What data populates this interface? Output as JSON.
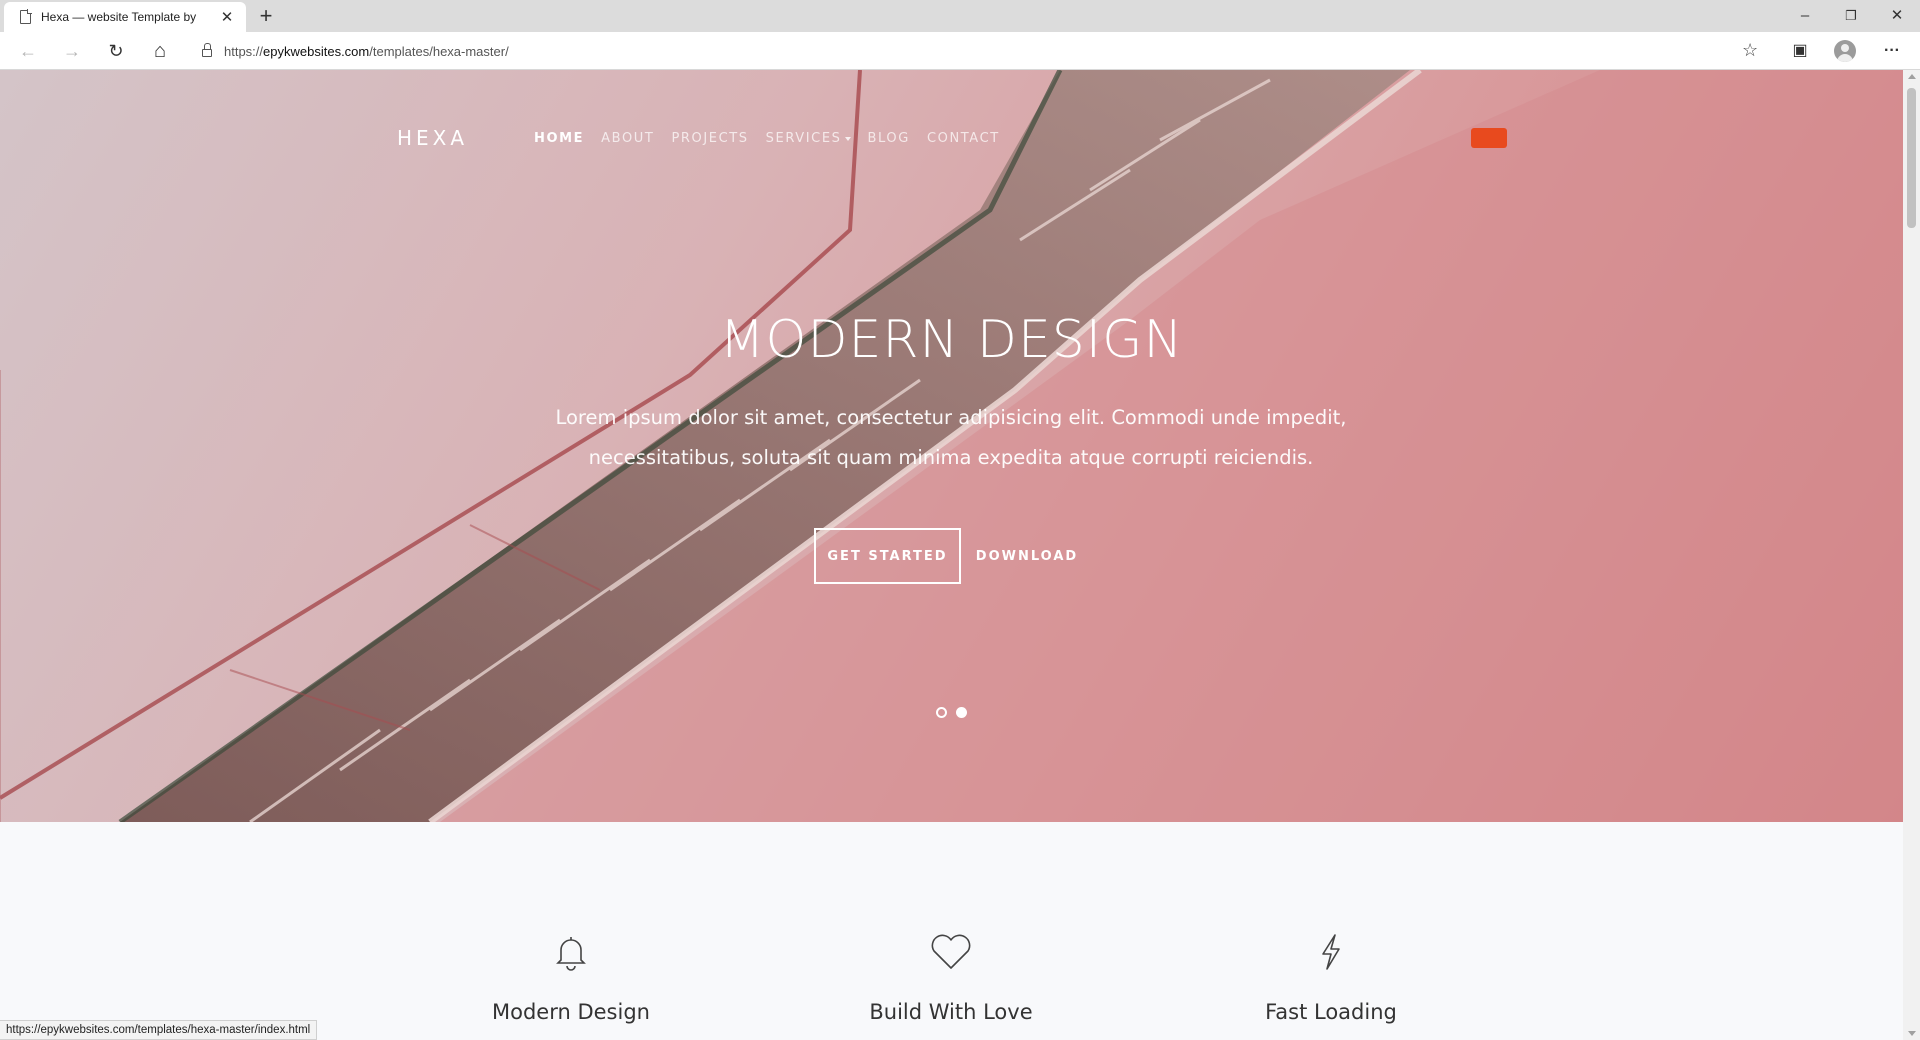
{
  "browser": {
    "tab_title": "Hexa — website Template by",
    "tab_close": "✕",
    "new_tab": "+",
    "url_prefix": "https://",
    "url_domain": "epykwebsites.com",
    "url_path": "/templates/hexa-master/",
    "status_url": "https://epykwebsites.com/templates/hexa-master/index.html",
    "window_controls": {
      "minimize": "–",
      "restore": "❐",
      "close": "✕"
    },
    "icons": {
      "back": "←",
      "forward": "→",
      "reload": "↻",
      "home": "⌂",
      "favorites": "☆",
      "collections": "▣",
      "menu": "···"
    }
  },
  "site": {
    "logo": "HEXA",
    "menu": [
      {
        "label": "HOME",
        "active": true
      },
      {
        "label": "ABOUT"
      },
      {
        "label": "PROJECTS"
      },
      {
        "label": "SERVICES"
      },
      {
        "label": "BLOG"
      },
      {
        "label": "CONTACT"
      }
    ],
    "cta_color": "#e84a1e"
  },
  "hero": {
    "title": "MODERN DESIGN",
    "subtitle": "Lorem ipsum dolor sit amet, consectetur adipisicing elit. Commodi unde impedit, necessitatibus, soluta sit quam minima expedita atque corrupti reiciendis.",
    "primary_button": "GET STARTED",
    "secondary_button": "DOWNLOAD",
    "slides": {
      "count": 2,
      "active": 2
    }
  },
  "features": [
    {
      "icon": "bell-icon",
      "title": "Modern Design"
    },
    {
      "icon": "heart-icon",
      "title": "Build With Love"
    },
    {
      "icon": "lightning-icon",
      "title": "Fast Loading"
    }
  ]
}
